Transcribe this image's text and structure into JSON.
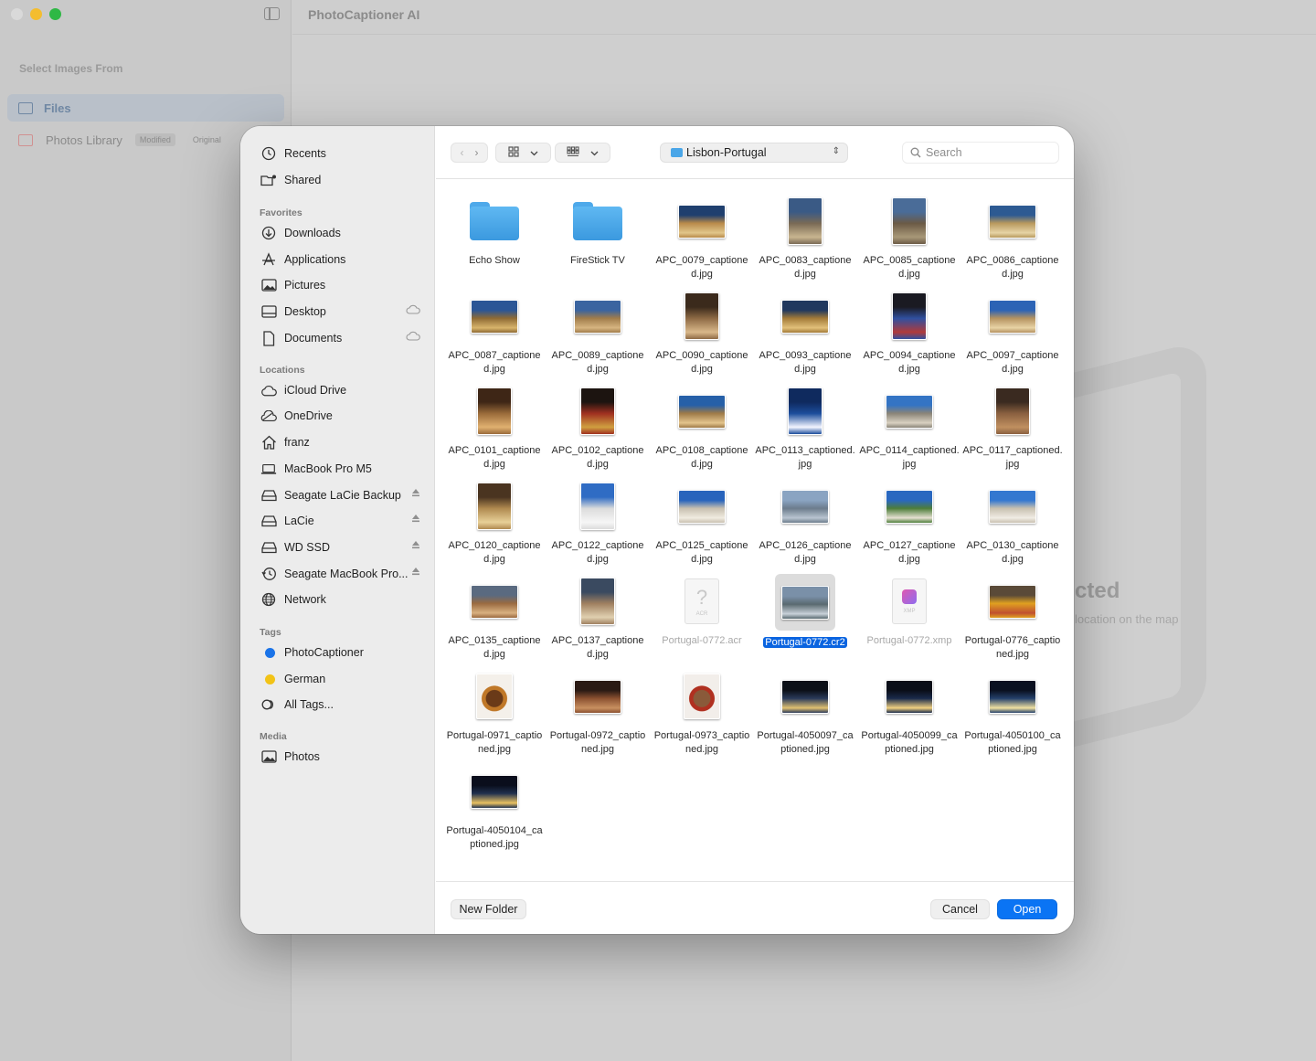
{
  "app": {
    "title": "PhotoCaptioner AI",
    "section": "Select Images From",
    "items": [
      {
        "label": "Files"
      },
      {
        "label": "Photos Library",
        "pills": [
          "Modified",
          "Original"
        ]
      }
    ],
    "bg_hint": "cted",
    "bg_sub": "location on the map"
  },
  "dialog": {
    "sidebar": {
      "top": [
        {
          "label": "Recents"
        },
        {
          "label": "Shared"
        }
      ],
      "favorites_head": "Favorites",
      "favorites": [
        {
          "label": "Downloads"
        },
        {
          "label": "Applications"
        },
        {
          "label": "Pictures"
        },
        {
          "label": "Desktop"
        },
        {
          "label": "Documents"
        }
      ],
      "locations_head": "Locations",
      "locations": [
        {
          "label": "iCloud Drive"
        },
        {
          "label": "OneDrive"
        },
        {
          "label": "franz"
        },
        {
          "label": "MacBook Pro M5"
        },
        {
          "label": "Seagate LaCie Backup"
        },
        {
          "label": "LaCie"
        },
        {
          "label": "WD SSD"
        },
        {
          "label": "Seagate MacBook Pro..."
        },
        {
          "label": "Network"
        }
      ],
      "tags_head": "Tags",
      "tags": [
        {
          "label": "PhotoCaptioner",
          "color": "#1a73e8"
        },
        {
          "label": "German",
          "color": "#f2c317"
        },
        {
          "label": "All Tags..."
        }
      ],
      "media_head": "Media",
      "media": [
        {
          "label": "Photos"
        }
      ]
    },
    "path": "Lisbon-Portugal",
    "search_placeholder": "Search",
    "files": [
      {
        "label": "Echo Show",
        "kind": "folder"
      },
      {
        "label": "FireStick TV",
        "kind": "folder"
      },
      {
        "label": "APC_0079_captioned.jpg",
        "kind": "land",
        "palette": [
          "#1f3f6e",
          "#b88a4a",
          "#e1c58a"
        ]
      },
      {
        "label": "APC_0083_captioned.jpg",
        "kind": "port",
        "palette": [
          "#3a5a85",
          "#7a6a55",
          "#c8b590"
        ]
      },
      {
        "label": "APC_0085_captioned.jpg",
        "kind": "port",
        "palette": [
          "#4a6c98",
          "#6b5a45",
          "#a89878"
        ]
      },
      {
        "label": "APC_0086_captioned.jpg",
        "kind": "land",
        "palette": [
          "#2d5a92",
          "#b8995e",
          "#e6d3a5"
        ]
      },
      {
        "label": "APC_0087_captioned.jpg",
        "kind": "land",
        "palette": [
          "#2b5696",
          "#8e6a34",
          "#d8b46b"
        ]
      },
      {
        "label": "APC_0089_captioned.jpg",
        "kind": "land",
        "palette": [
          "#3a64a0",
          "#a07c4a",
          "#d6b480"
        ]
      },
      {
        "label": "APC_0090_captioned.jpg",
        "kind": "port",
        "palette": [
          "#3b2a1c",
          "#8e6a45",
          "#d9b88a"
        ]
      },
      {
        "label": "APC_0093_captioned.jpg",
        "kind": "land",
        "palette": [
          "#20385e",
          "#a27a38",
          "#e2c07a"
        ]
      },
      {
        "label": "APC_0094_captioned.jpg",
        "kind": "port",
        "palette": [
          "#1a1a22",
          "#3050a0",
          "#b03a3a"
        ]
      },
      {
        "label": "APC_0097_captioned.jpg",
        "kind": "land",
        "palette": [
          "#2c63b5",
          "#b49260",
          "#e8d3a5"
        ]
      },
      {
        "label": "APC_0101_captioned.jpg",
        "kind": "port",
        "palette": [
          "#3e2616",
          "#9a6b3a",
          "#e0b070"
        ]
      },
      {
        "label": "APC_0102_captioned.jpg",
        "kind": "port",
        "palette": [
          "#1c1410",
          "#a03020",
          "#d0a040"
        ]
      },
      {
        "label": "APC_0108_captioned.jpg",
        "kind": "land",
        "palette": [
          "#2660a8",
          "#9e7a48",
          "#e3c48c"
        ]
      },
      {
        "label": "APC_0113_captioned.jpg",
        "kind": "port",
        "palette": [
          "#0f2a5e",
          "#1c4d9c",
          "#f4f6ff"
        ]
      },
      {
        "label": "APC_0114_captioned.jpg",
        "kind": "land",
        "palette": [
          "#3474c4",
          "#8a8478",
          "#d8d0c0"
        ]
      },
      {
        "label": "APC_0117_captioned.jpg",
        "kind": "port",
        "palette": [
          "#3a2a20",
          "#8a6040",
          "#c09060"
        ]
      },
      {
        "label": "APC_0120_captioned.jpg",
        "kind": "port",
        "palette": [
          "#4a3420",
          "#b08a50",
          "#e8d098"
        ]
      },
      {
        "label": "APC_0122_captioned.jpg",
        "kind": "port",
        "palette": [
          "#2f6cc4",
          "#dcdcdc",
          "#f6f6f6"
        ]
      },
      {
        "label": "APC_0125_captioned.jpg",
        "kind": "land",
        "palette": [
          "#2864bc",
          "#c8c0b0",
          "#f0ebe0"
        ]
      },
      {
        "label": "APC_0126_captioned.jpg",
        "kind": "land",
        "palette": [
          "#8aa4c2",
          "#6c7c8c",
          "#b8c4d0"
        ]
      },
      {
        "label": "APC_0127_captioned.jpg",
        "kind": "land",
        "palette": [
          "#2a68c0",
          "#4d7d3a",
          "#e6e0d2"
        ]
      },
      {
        "label": "APC_0130_captioned.jpg",
        "kind": "land",
        "palette": [
          "#3478d0",
          "#c8c0b0",
          "#f0ece4"
        ]
      },
      {
        "label": "APC_0135_captioned.jpg",
        "kind": "land",
        "palette": [
          "#5a6a80",
          "#9a6a40",
          "#d8b080"
        ]
      },
      {
        "label": "APC_0137_captioned.jpg",
        "kind": "port",
        "palette": [
          "#3a4a60",
          "#a08060",
          "#e0d0b0"
        ]
      },
      {
        "label": "Portugal-0772.acr",
        "kind": "doc",
        "dim": true,
        "doc_text": "ACR"
      },
      {
        "label": "Portugal-0772.cr2",
        "kind": "land",
        "selected": true,
        "palette": [
          "#7a90a8",
          "#5a6a70",
          "#c8d0d8"
        ]
      },
      {
        "label": "Portugal-0772.xmp",
        "kind": "xmp",
        "dim": true,
        "doc_text": "XMP"
      },
      {
        "label": "Portugal-0776_captioned.jpg",
        "kind": "land",
        "palette": [
          "#5a4a38",
          "#e0a020",
          "#c05030"
        ]
      },
      {
        "label": "Portugal-0971_captioned.jpg",
        "kind": "plate",
        "palette": [
          "#f4f0ea",
          "#c07828",
          "#6a3a18"
        ]
      },
      {
        "label": "Portugal-0972_captioned.jpg",
        "kind": "land",
        "palette": [
          "#2a1a14",
          "#8a5030",
          "#c89060"
        ]
      },
      {
        "label": "Portugal-0973_captioned.jpg",
        "kind": "plate",
        "palette": [
          "#f2eeea",
          "#b03020",
          "#8a5a3a"
        ]
      },
      {
        "label": "Portugal-4050097_captioned.jpg",
        "kind": "land",
        "palette": [
          "#0c1018",
          "#2a3a5a",
          "#e0c070"
        ]
      },
      {
        "label": "Portugal-4050099_captioned.jpg",
        "kind": "land",
        "palette": [
          "#0a0e18",
          "#1a2a4a",
          "#f0d080"
        ]
      },
      {
        "label": "Portugal-4050100_captioned.jpg",
        "kind": "land",
        "palette": [
          "#0a1020",
          "#24406a",
          "#f0e0a0"
        ]
      },
      {
        "label": "Portugal-4050104_captioned.jpg",
        "kind": "land",
        "palette": [
          "#0a0e1c",
          "#20304e",
          "#e8c060"
        ]
      }
    ],
    "footer": {
      "new_folder": "New Folder",
      "cancel": "Cancel",
      "open": "Open"
    }
  }
}
